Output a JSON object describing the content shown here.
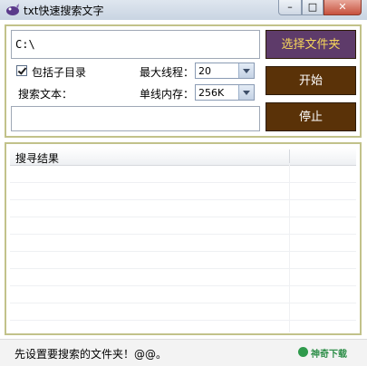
{
  "window": {
    "title": "txt快速搜索文字",
    "min_glyph": "–",
    "max_glyph": "□",
    "close_glyph": "✕"
  },
  "form": {
    "path_value": "C:\\",
    "choose_folder_label": "选择文件夹",
    "start_label": "开始",
    "stop_label": "停止",
    "subdir_label": "包括子目录",
    "subdir_checked": true,
    "max_threads_label": "最大线程：",
    "max_threads_value": "20",
    "search_text_label": "搜索文本：",
    "thread_memory_label": "单线内存：",
    "thread_memory_value": "256K",
    "search_text_value": ""
  },
  "results": {
    "column_title": "搜寻结果",
    "rows": []
  },
  "status": {
    "message": "先设置要搜索的文件夹！@@。",
    "watermark": "神奇下载"
  },
  "colors": {
    "panel_border": "#c2c28a",
    "choose_button_bg": "#5e3b6a",
    "choose_button_text": "#f5d55a",
    "action_button_bg": "#5a3208"
  }
}
